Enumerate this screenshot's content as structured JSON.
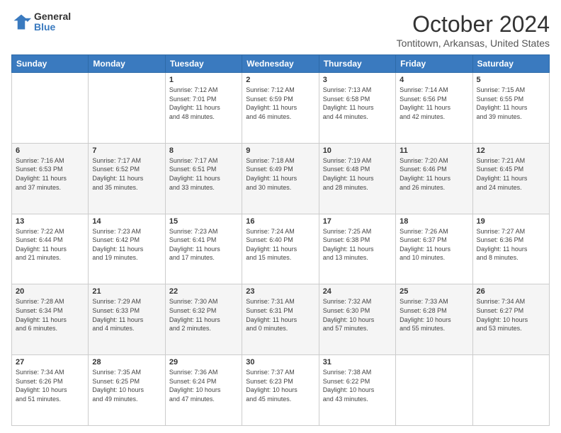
{
  "logo": {
    "general": "General",
    "blue": "Blue"
  },
  "title": "October 2024",
  "subtitle": "Tontitown, Arkansas, United States",
  "days_of_week": [
    "Sunday",
    "Monday",
    "Tuesday",
    "Wednesday",
    "Thursday",
    "Friday",
    "Saturday"
  ],
  "weeks": [
    [
      {
        "day": "",
        "info": ""
      },
      {
        "day": "",
        "info": ""
      },
      {
        "day": "1",
        "info": "Sunrise: 7:12 AM\nSunset: 7:01 PM\nDaylight: 11 hours\nand 48 minutes."
      },
      {
        "day": "2",
        "info": "Sunrise: 7:12 AM\nSunset: 6:59 PM\nDaylight: 11 hours\nand 46 minutes."
      },
      {
        "day": "3",
        "info": "Sunrise: 7:13 AM\nSunset: 6:58 PM\nDaylight: 11 hours\nand 44 minutes."
      },
      {
        "day": "4",
        "info": "Sunrise: 7:14 AM\nSunset: 6:56 PM\nDaylight: 11 hours\nand 42 minutes."
      },
      {
        "day": "5",
        "info": "Sunrise: 7:15 AM\nSunset: 6:55 PM\nDaylight: 11 hours\nand 39 minutes."
      }
    ],
    [
      {
        "day": "6",
        "info": "Sunrise: 7:16 AM\nSunset: 6:53 PM\nDaylight: 11 hours\nand 37 minutes."
      },
      {
        "day": "7",
        "info": "Sunrise: 7:17 AM\nSunset: 6:52 PM\nDaylight: 11 hours\nand 35 minutes."
      },
      {
        "day": "8",
        "info": "Sunrise: 7:17 AM\nSunset: 6:51 PM\nDaylight: 11 hours\nand 33 minutes."
      },
      {
        "day": "9",
        "info": "Sunrise: 7:18 AM\nSunset: 6:49 PM\nDaylight: 11 hours\nand 30 minutes."
      },
      {
        "day": "10",
        "info": "Sunrise: 7:19 AM\nSunset: 6:48 PM\nDaylight: 11 hours\nand 28 minutes."
      },
      {
        "day": "11",
        "info": "Sunrise: 7:20 AM\nSunset: 6:46 PM\nDaylight: 11 hours\nand 26 minutes."
      },
      {
        "day": "12",
        "info": "Sunrise: 7:21 AM\nSunset: 6:45 PM\nDaylight: 11 hours\nand 24 minutes."
      }
    ],
    [
      {
        "day": "13",
        "info": "Sunrise: 7:22 AM\nSunset: 6:44 PM\nDaylight: 11 hours\nand 21 minutes."
      },
      {
        "day": "14",
        "info": "Sunrise: 7:23 AM\nSunset: 6:42 PM\nDaylight: 11 hours\nand 19 minutes."
      },
      {
        "day": "15",
        "info": "Sunrise: 7:23 AM\nSunset: 6:41 PM\nDaylight: 11 hours\nand 17 minutes."
      },
      {
        "day": "16",
        "info": "Sunrise: 7:24 AM\nSunset: 6:40 PM\nDaylight: 11 hours\nand 15 minutes."
      },
      {
        "day": "17",
        "info": "Sunrise: 7:25 AM\nSunset: 6:38 PM\nDaylight: 11 hours\nand 13 minutes."
      },
      {
        "day": "18",
        "info": "Sunrise: 7:26 AM\nSunset: 6:37 PM\nDaylight: 11 hours\nand 10 minutes."
      },
      {
        "day": "19",
        "info": "Sunrise: 7:27 AM\nSunset: 6:36 PM\nDaylight: 11 hours\nand 8 minutes."
      }
    ],
    [
      {
        "day": "20",
        "info": "Sunrise: 7:28 AM\nSunset: 6:34 PM\nDaylight: 11 hours\nand 6 minutes."
      },
      {
        "day": "21",
        "info": "Sunrise: 7:29 AM\nSunset: 6:33 PM\nDaylight: 11 hours\nand 4 minutes."
      },
      {
        "day": "22",
        "info": "Sunrise: 7:30 AM\nSunset: 6:32 PM\nDaylight: 11 hours\nand 2 minutes."
      },
      {
        "day": "23",
        "info": "Sunrise: 7:31 AM\nSunset: 6:31 PM\nDaylight: 11 hours\nand 0 minutes."
      },
      {
        "day": "24",
        "info": "Sunrise: 7:32 AM\nSunset: 6:30 PM\nDaylight: 10 hours\nand 57 minutes."
      },
      {
        "day": "25",
        "info": "Sunrise: 7:33 AM\nSunset: 6:28 PM\nDaylight: 10 hours\nand 55 minutes."
      },
      {
        "day": "26",
        "info": "Sunrise: 7:34 AM\nSunset: 6:27 PM\nDaylight: 10 hours\nand 53 minutes."
      }
    ],
    [
      {
        "day": "27",
        "info": "Sunrise: 7:34 AM\nSunset: 6:26 PM\nDaylight: 10 hours\nand 51 minutes."
      },
      {
        "day": "28",
        "info": "Sunrise: 7:35 AM\nSunset: 6:25 PM\nDaylight: 10 hours\nand 49 minutes."
      },
      {
        "day": "29",
        "info": "Sunrise: 7:36 AM\nSunset: 6:24 PM\nDaylight: 10 hours\nand 47 minutes."
      },
      {
        "day": "30",
        "info": "Sunrise: 7:37 AM\nSunset: 6:23 PM\nDaylight: 10 hours\nand 45 minutes."
      },
      {
        "day": "31",
        "info": "Sunrise: 7:38 AM\nSunset: 6:22 PM\nDaylight: 10 hours\nand 43 minutes."
      },
      {
        "day": "",
        "info": ""
      },
      {
        "day": "",
        "info": ""
      }
    ]
  ]
}
